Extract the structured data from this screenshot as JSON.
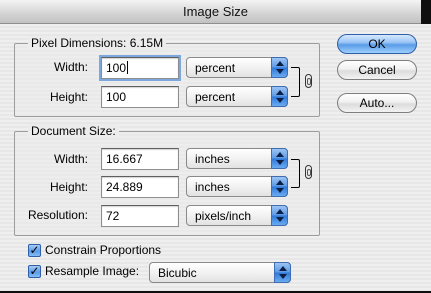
{
  "window": {
    "title": "Image Size"
  },
  "pixel_dimensions": {
    "label": "Pixel Dimensions:",
    "size": "6.15M",
    "width": {
      "label": "Width:",
      "value": "100",
      "unit": "percent"
    },
    "height": {
      "label": "Height:",
      "value": "100",
      "unit": "percent"
    }
  },
  "document_size": {
    "label": "Document Size:",
    "width": {
      "label": "Width:",
      "value": "16.667",
      "unit": "inches"
    },
    "height": {
      "label": "Height:",
      "value": "24.889",
      "unit": "inches"
    },
    "resolution": {
      "label": "Resolution:",
      "value": "72",
      "unit": "pixels/inch"
    }
  },
  "options": {
    "constrain_proportions": {
      "label": "Constrain Proportions",
      "checked": true
    },
    "resample_image": {
      "label": "Resample Image:",
      "checked": true,
      "method": "Bicubic"
    }
  },
  "buttons": {
    "ok": "OK",
    "cancel": "Cancel",
    "auto": "Auto..."
  },
  "colors": {
    "accent": "#5b9ce8",
    "window_bg": "#ececec"
  },
  "icons": {
    "link": "chain-link-icon",
    "check": "checkmark-icon",
    "popup": "up-down-arrows-icon"
  }
}
